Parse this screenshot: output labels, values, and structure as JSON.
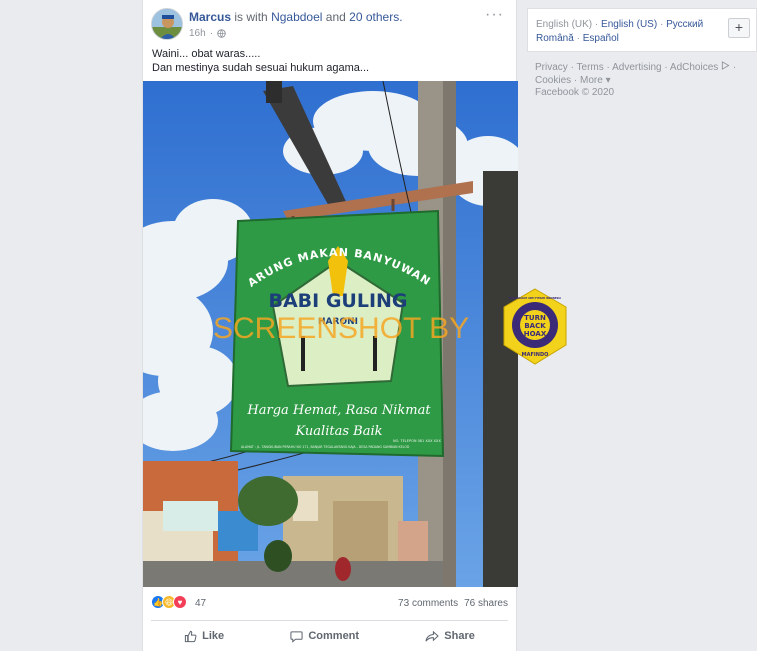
{
  "post": {
    "author_name": "Marcus",
    "with_text": "is with",
    "tagged_friend": "Ngabdoel",
    "and_text": "and",
    "others_label": "20 others.",
    "timestamp": "16h",
    "privacy_icon": "globe-icon",
    "text_lines": [
      "Waini... obat waras.....",
      "Dan mestinya sudah sesuai hukum agama..."
    ]
  },
  "image": {
    "sign_header": "WARUNG MAKAN BANYUWANGI",
    "sign_title": "BABI GULING",
    "sign_subtitle": "HARONI",
    "sign_tagline_1": "Harga Hemat, Rasa Nikmat",
    "sign_tagline_2": "Kualitas Baik",
    "sign_address": "ALAMAT : JL. TANGKUBAN PERAHU NO 171, BANJAR TEGALANTANG KAJA - DESA PADANG SAMBIAN KELOD",
    "sign_phone": "NO. TELEPON 081 XXX XXX",
    "watermark": "SCREENSHOT BY",
    "badge_top": "MASYARAKAT ANTI FITNAH INDONESIA",
    "badge_line_1": "TURN",
    "badge_line_2": "BACK",
    "badge_line_3": "HOAX",
    "badge_bottom": "MAFINDO",
    "colors": {
      "sky": "#3f7fd6",
      "sign_green": "#2f9a45",
      "sign_light": "#dceec4",
      "watermark": "#f5a623",
      "badge": "#f2d21a"
    }
  },
  "footer": {
    "reaction_count": "47",
    "comments": "73 comments",
    "shares": "76 shares",
    "actions": {
      "like": "Like",
      "comment": "Comment",
      "share": "Share"
    }
  },
  "sidebar": {
    "languages": {
      "current": "English (UK)",
      "options": [
        "English (US)",
        "Русский",
        "Română",
        "Español"
      ],
      "separator": "·"
    },
    "add_language_label": "+",
    "footer_links": [
      "Privacy",
      "Terms",
      "Advertising",
      "AdChoices",
      "Cookies",
      "More"
    ],
    "copyright": "Facebook © 2020"
  },
  "colors": {
    "page_bg": "#e9ebee",
    "link_blue": "#365899",
    "muted": "#90949c"
  }
}
